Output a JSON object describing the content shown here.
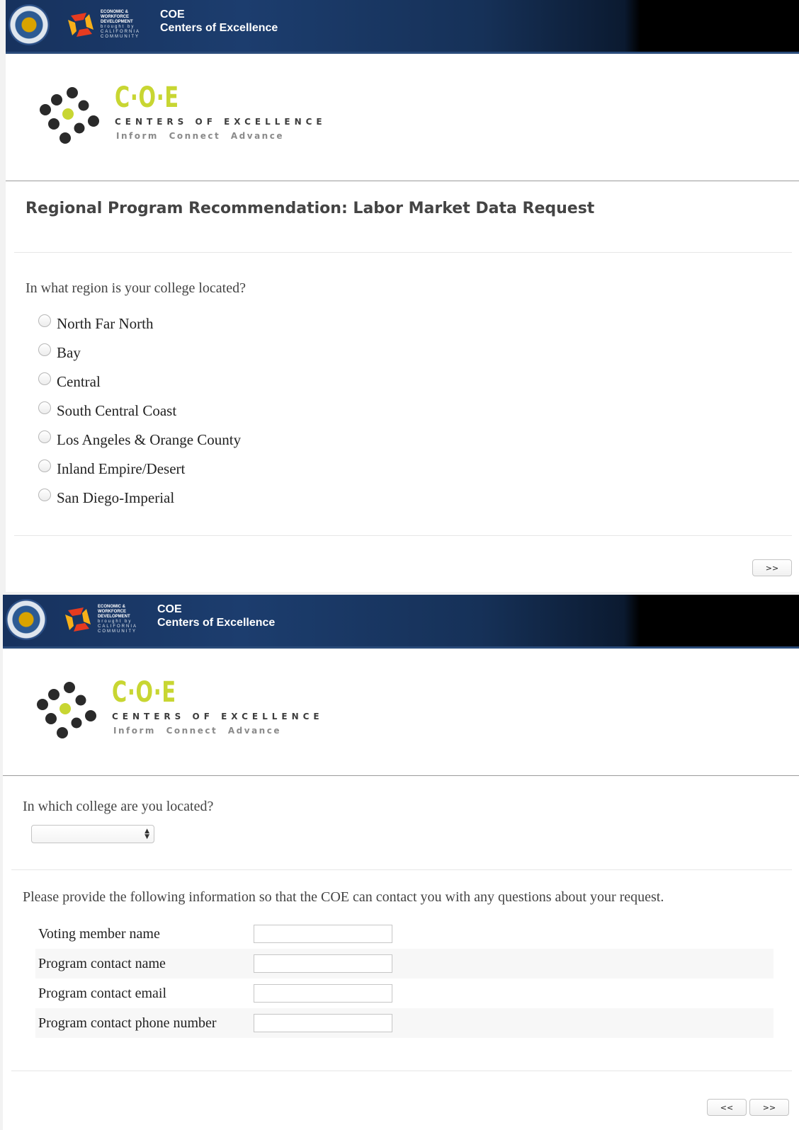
{
  "banner": {
    "title_line1": "COE",
    "title_line2": "Centers of Excellence",
    "partner_logo_text": [
      "ECONOMIC &",
      "WORKFORCE",
      "DEVELOPMENT",
      "brought by",
      "CALIFORNIA",
      "COMMUNITY",
      "COLLEGES"
    ]
  },
  "logo": {
    "mark": "C·O·E",
    "line1": "CENTERS OF EXCELLENCE",
    "line2": "Inform Connect Advance"
  },
  "page1": {
    "title": "Regional Program Recommendation: Labor Market Data Request",
    "question": "In what region is your college located?",
    "options": [
      "North Far North",
      "Bay",
      "Central",
      "South Central Coast",
      "Los Angeles & Orange County",
      "Inland Empire/Desert",
      "San Diego-Imperial"
    ],
    "next_label": ">>"
  },
  "page2": {
    "question": "In which college are you located?",
    "college_select_value": "",
    "info_text": "Please provide the following information so that the COE can contact you with any questions about your request.",
    "fields": [
      {
        "label": "Voting member name",
        "value": ""
      },
      {
        "label": "Program contact name",
        "value": ""
      },
      {
        "label": "Program contact email",
        "value": ""
      },
      {
        "label": "Program contact phone number",
        "value": ""
      }
    ],
    "back_label": "<<",
    "next_label": ">>"
  },
  "colors": {
    "banner_blue": "#1c3d6e",
    "coe_green": "#c8d632",
    "dot_dark": "#2a2a2a"
  }
}
